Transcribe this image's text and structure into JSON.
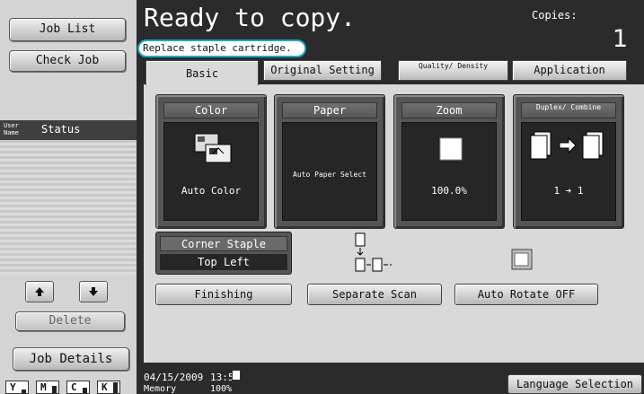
{
  "sidebar": {
    "job_list": "Job List",
    "check_job": "Check Job",
    "col_user": "User Name",
    "col_status": "Status",
    "delete": "Delete",
    "job_details": "Job Details",
    "toners": [
      "Y",
      "M",
      "C",
      "K"
    ]
  },
  "header": {
    "title": "Ready to copy.",
    "message": "Replace staple cartridge.",
    "copies_label": "Copies:",
    "copies_value": "1"
  },
  "tabs": {
    "basic": "Basic",
    "original": "Original Setting",
    "quality": "Quality/ Density",
    "application": "Application"
  },
  "functions": {
    "color": {
      "label": "Color",
      "value": "Auto Color"
    },
    "paper": {
      "label": "Paper",
      "value": "Auto Paper Select"
    },
    "zoom": {
      "label": "Zoom",
      "value": "100.0%"
    },
    "duplex": {
      "label": "Duplex/ Combine",
      "value": "1 ➔ 1"
    }
  },
  "finishing": {
    "corner_staple_label": "Corner Staple",
    "corner_staple_value": "Top Left",
    "finishing_button": "Finishing",
    "separate_scan": "Separate Scan",
    "auto_rotate": "Auto Rotate OFF"
  },
  "status": {
    "date": "04/15/2009",
    "time": "13:50",
    "memory_label": "Memory",
    "memory_value": "100%",
    "language": "Language Selection"
  }
}
